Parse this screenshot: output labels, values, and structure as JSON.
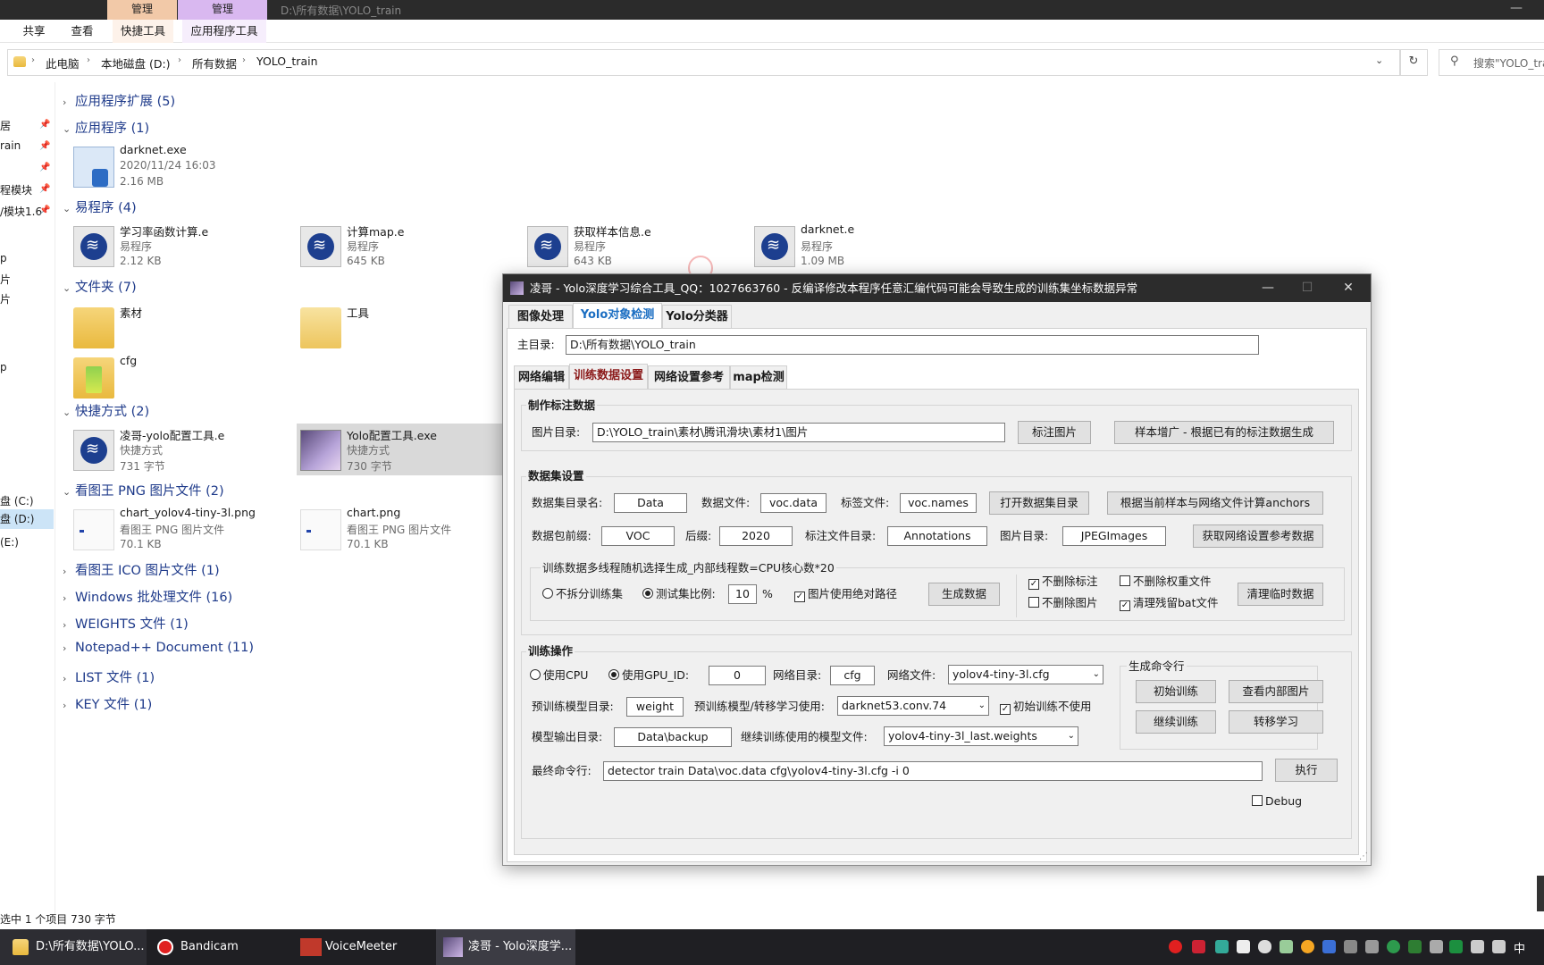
{
  "explorer": {
    "window_title": "D:\\所有数据\\YOLO_train",
    "context_tabs": [
      "管理",
      "管理"
    ],
    "ribbon_tabs": [
      "共享",
      "查看",
      "快捷工具",
      "应用程序工具"
    ],
    "breadcrumb": [
      "此电脑",
      "本地磁盘 (D:)",
      "所有数据",
      "YOLO_train"
    ],
    "search_placeholder": "搜索\"YOLO_tra",
    "nav_items": [
      {
        "label": "居",
        "pinned": true
      },
      {
        "label": "rain",
        "pinned": true
      },
      {
        "label": "",
        "pinned": true
      },
      {
        "label": "程模块",
        "pinned": true
      },
      {
        "label": "/模块1.6",
        "pinned": true
      },
      {
        "label": "p",
        "pinned": false
      },
      {
        "label": "片",
        "pinned": false
      },
      {
        "label": "片",
        "pinned": false
      },
      {
        "label": "",
        "pinned": false
      },
      {
        "label": "p",
        "pinned": false
      },
      {
        "label": "盘 (C:)",
        "pinned": false
      },
      {
        "label": "盘 (D:)",
        "pinned": false
      },
      {
        "label": "(E:)",
        "pinned": false
      }
    ],
    "groups": {
      "g1": "应用程序扩展 (5)",
      "g2": "应用程序 (1)",
      "g3": "易程序 (4)",
      "g4": "文件夹 (7)",
      "g5": "快捷方式 (2)",
      "g6": "看图王 PNG 图片文件 (2)",
      "g7": "看图王 ICO 图片文件 (1)",
      "g8": "Windows 批处理文件 (16)",
      "g9": "WEIGHTS 文件 (1)",
      "g10": "Notepad++ Document (11)",
      "g11": "LIST 文件 (1)",
      "g12": "KEY 文件 (1)"
    },
    "apps": [
      {
        "name": "darknet.exe",
        "meta1": "2020/11/24 16:03",
        "meta2": "2.16 MB"
      }
    ],
    "e_files": [
      {
        "name": "学习率函数计算.e",
        "meta1": "易程序",
        "meta2": "2.12 KB"
      },
      {
        "name": "计算map.e",
        "meta1": "易程序",
        "meta2": "645 KB"
      },
      {
        "name": "获取样本信息.e",
        "meta1": "易程序",
        "meta2": "643 KB"
      },
      {
        "name": "darknet.e",
        "meta1": "易程序",
        "meta2": "1.09 MB"
      }
    ],
    "folders": [
      {
        "name": "素材"
      },
      {
        "name": "工具"
      },
      {
        "name": "cfg"
      }
    ],
    "shortcuts": [
      {
        "name": "凌哥-yolo配置工具.e",
        "meta1": "快捷方式",
        "meta2": "731 字节"
      },
      {
        "name": "Yolo配置工具.exe",
        "meta1": "快捷方式",
        "meta2": "730 字节"
      }
    ],
    "pngs": [
      {
        "name": "chart_yolov4-tiny-3l.png",
        "meta1": "看图王 PNG 图片文件",
        "meta2": "70.1 KB"
      },
      {
        "name": "chart.png",
        "meta1": "看图王 PNG 图片文件",
        "meta2": "70.1 KB"
      }
    ],
    "status": "选中 1 个项目  730 字节"
  },
  "taskbar": {
    "items": [
      "D:\\所有数据\\YOLO...",
      "Bandicam",
      "VoiceMeeter",
      "凌哥 - Yolo深度学..."
    ],
    "voice_icon_text": "VOICE\nMETER",
    "tray_text": "中"
  },
  "app": {
    "title": "凌哥 - Yolo深度学习综合工具_QQ：1027663760 - 反编译修改本程序任意汇编代码可能会导致生成的训练集坐标数据异常",
    "main_tabs": [
      "图像处理",
      "Yolo对象检测",
      "Yolo分类器"
    ],
    "root_label": "主目录:",
    "root_value": "D:\\所有数据\\YOLO_train",
    "sub_tabs": [
      "网络编辑",
      "训练数据设置",
      "网络设置参考",
      "map检测"
    ],
    "annotate": {
      "title": "制作标注数据",
      "img_dir_label": "图片目录:",
      "img_dir_value": "D:\\YOLO_train\\素材\\腾讯滑块\\素材1\\图片",
      "annotate_btn": "标注图片",
      "augment_btn": "样本增广 - 根据已有的标注数据生成"
    },
    "dataset": {
      "title": "数据集设置",
      "dir_name_label": "数据集目录名:",
      "dir_name_value": "Data",
      "data_file_label": "数据文件:",
      "data_file_value": "voc.data",
      "label_file_label": "标签文件:",
      "label_file_value": "voc.names",
      "open_dir_btn": "打开数据集目录",
      "anchors_btn": "根据当前样本与网络文件计算anchors",
      "prefix_label": "数据包前缀:",
      "prefix_value": "VOC",
      "suffix_label": "后缀:",
      "suffix_value": "2020",
      "ann_dir_label": "标注文件目录:",
      "ann_dir_value": "Annotations",
      "img_dir_label": "图片目录:",
      "img_dir_value": "JPEGImages",
      "ref_btn": "获取网络设置参考数据",
      "multi_title": "训练数据多线程随机选择生成_内部线程数=CPU核心数*20",
      "no_split_label": "不拆分训练集",
      "test_ratio_label": "测试集比例:",
      "test_ratio_value": "10",
      "percent": "%",
      "abs_path_label": "图片使用绝对路径",
      "gen_btn": "生成数据",
      "keep_ann_label": "不删除标注",
      "keep_weights_label": "不删除权重文件",
      "keep_img_label": "不删除图片",
      "clean_bat_label": "清理残留bat文件",
      "clean_tmp_btn": "清理临时数据"
    },
    "train": {
      "title": "训练操作",
      "cpu_label": "使用CPU",
      "gpu_label": "使用GPU_ID:",
      "gpu_value": "0",
      "net_dir_label": "网络目录:",
      "net_dir_value": "cfg",
      "net_file_label": "网络文件:",
      "net_file_value": "yolov4-tiny-3l.cfg",
      "pre_dir_label": "预训练模型目录:",
      "pre_dir_value": "weight",
      "pre_use_label": "预训练模型/转移学习使用:",
      "pre_use_value": "darknet53.conv.74",
      "no_init_label": "初始训练不使用",
      "out_dir_label": "模型输出目录:",
      "out_dir_value": "Data\\backup",
      "cont_label": "继续训练使用的模型文件:",
      "cont_value": "yolov4-tiny-3l_last.weights",
      "gen_cmd_title": "生成命令行",
      "init_train_btn": "初始训练",
      "view_img_btn": "查看内部图片",
      "cont_train_btn": "继续训练",
      "transfer_btn": "转移学习",
      "cmd_label": "最终命令行:",
      "cmd_value": "detector train Data\\voc.data cfg\\yolov4-tiny-3l.cfg -i 0",
      "exec_btn": "执行",
      "debug_label": "Debug"
    }
  }
}
